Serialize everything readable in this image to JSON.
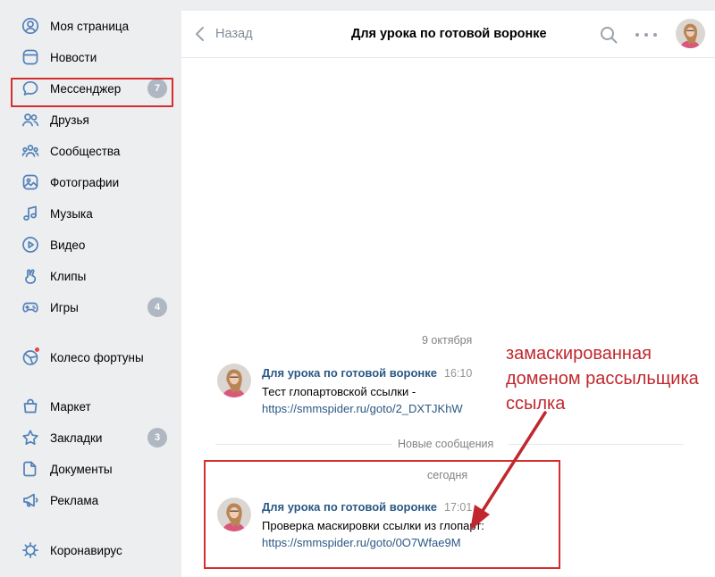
{
  "sidebar": {
    "items": [
      {
        "label": "Моя страница",
        "icon": "user-circle-icon"
      },
      {
        "label": "Новости",
        "icon": "news-icon"
      },
      {
        "label": "Мессенджер",
        "icon": "chat-bubble-icon",
        "badge": "7"
      },
      {
        "label": "Друзья",
        "icon": "friends-icon"
      },
      {
        "label": "Сообщества",
        "icon": "communities-icon"
      },
      {
        "label": "Фотографии",
        "icon": "photo-icon"
      },
      {
        "label": "Музыка",
        "icon": "music-note-icon"
      },
      {
        "label": "Видео",
        "icon": "video-play-icon"
      },
      {
        "label": "Клипы",
        "icon": "clips-hand-icon"
      },
      {
        "label": "Игры",
        "icon": "gamepad-icon",
        "badge": "4"
      },
      {
        "label": "Колесо фортуны",
        "icon": "fortune-wheel-icon"
      },
      {
        "label": "Маркет",
        "icon": "shopping-bag-icon"
      },
      {
        "label": "Закладки",
        "icon": "star-icon",
        "badge": "3"
      },
      {
        "label": "Документы",
        "icon": "document-icon"
      },
      {
        "label": "Реклама",
        "icon": "megaphone-icon"
      },
      {
        "label": "Коронавирус",
        "icon": "virus-icon"
      }
    ]
  },
  "header": {
    "back_label": "Назад",
    "title": "Для урока по готовой воронке"
  },
  "chat": {
    "date1": "9 октября",
    "msg1": {
      "author": "Для урока по готовой воронке",
      "time": "16:10",
      "text": "Тест глопартовской ссылки -",
      "link": "https://smmspider.ru/goto/2_DXTJKhW"
    },
    "new_messages_label": "Новые сообщения",
    "date2": "сегодня",
    "msg2": {
      "author": "Для урока по готовой воронке",
      "time": "17:01",
      "text": "Проверка маскировки ссылки из глопарт:",
      "link": "https://smmspider.ru/goto/0O7Wfae9M"
    }
  },
  "annotation": {
    "text": "замаскированная\nдоменом рассыльщика\nссылка",
    "color": "#c0282e"
  },
  "colors": {
    "accent": "#5181b8",
    "link": "#2a5885",
    "highlight": "#d52e2e"
  }
}
